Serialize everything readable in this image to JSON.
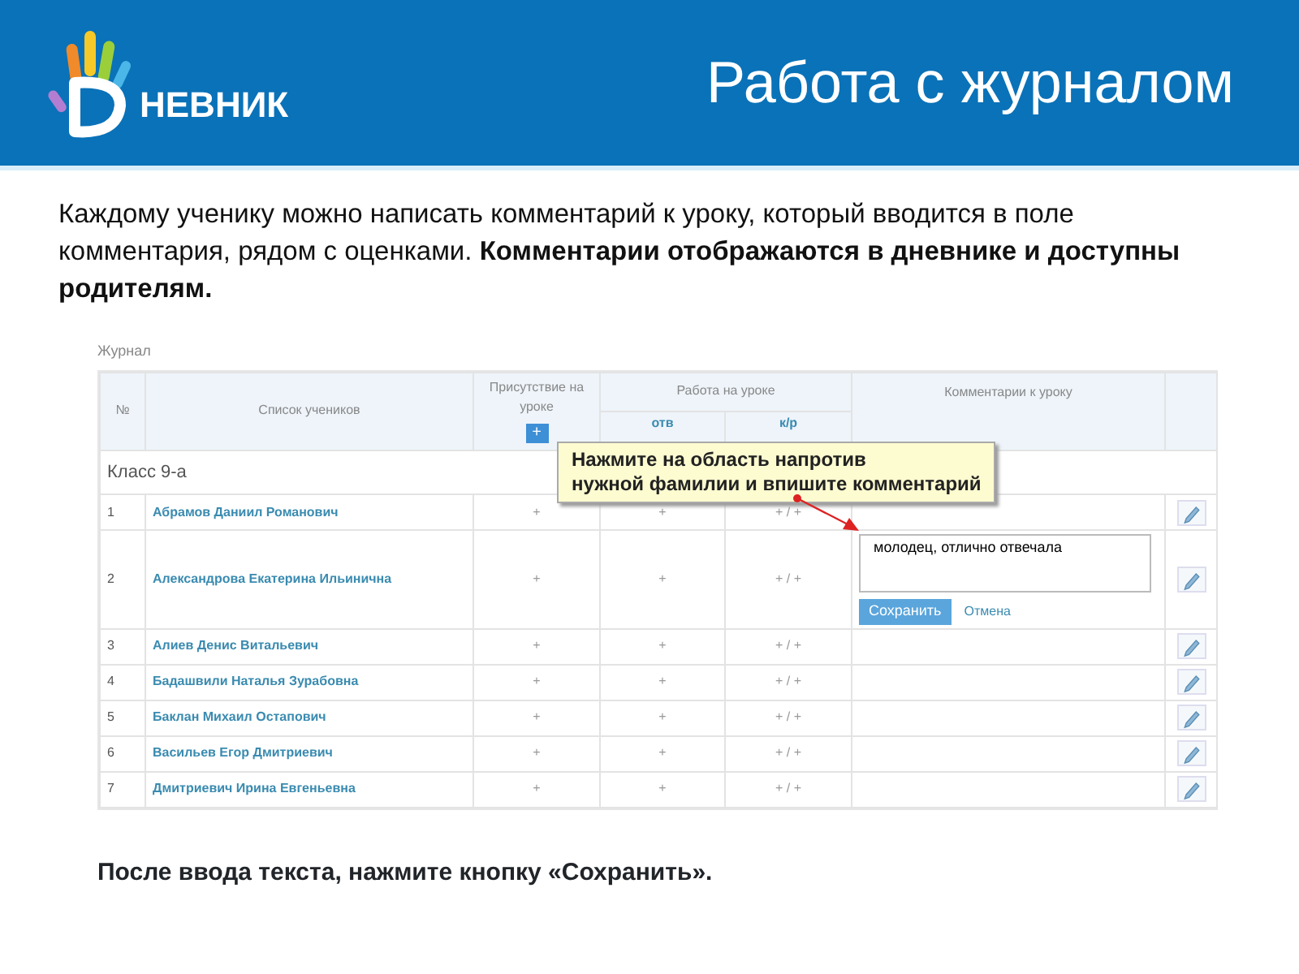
{
  "header": {
    "logo_text": "НЕВНИК",
    "title": "Работа с журналом"
  },
  "intro": "Каждому ученику можно написать комментарий к уроку, который вводится в поле комментария, рядом с оценками. **Комментарии отображаются в дневнике и доступны родителям.**",
  "journal": {
    "title": "Журнал",
    "columns": {
      "number": "№",
      "name": "Список учеников",
      "presence": "Присутствие на уроке",
      "group": "Работа на уроке",
      "answer": "отв",
      "test": "к/р",
      "comment": "Комментарии к уроку"
    },
    "add_button": "+",
    "class_label": "Класс 9-а",
    "rows": [
      {
        "number": "1",
        "name": "Абрамов Даниил Романович",
        "presence": "+",
        "answer": "+",
        "test": "+ / +",
        "editing": false
      },
      {
        "number": "2",
        "name": "Александрова Екатерина Ильинична",
        "presence": "+",
        "answer": "+",
        "test": "+ / +",
        "editing": true
      },
      {
        "number": "3",
        "name": "Алиев Денис Витальевич",
        "presence": "+",
        "answer": "+",
        "test": "+ / +",
        "editing": false
      },
      {
        "number": "4",
        "name": "Бадашвили Наталья Зурабовна",
        "presence": "+",
        "answer": "+",
        "test": "+ / +",
        "editing": false
      },
      {
        "number": "5",
        "name": "Баклан Михаил Остапович",
        "presence": "+",
        "answer": "+",
        "test": "+ / +",
        "editing": false
      },
      {
        "number": "6",
        "name": "Васильев Егор Дмитриевич",
        "presence": "+",
        "answer": "+",
        "test": "+ / +",
        "editing": false
      },
      {
        "number": "7",
        "name": "Дмитриевич Ирина Евгеньевна",
        "presence": "+",
        "answer": "+",
        "test": "+ / +",
        "editing": false
      }
    ],
    "editor": {
      "value": "молодец, отлично отвечала",
      "save": "Сохранить",
      "cancel": "Отмена"
    },
    "tooltip": {
      "lines": [
        "Нажмите на область напротив",
        "нужной фамилии и впишите комментарий"
      ]
    }
  },
  "footer": "После ввода текста, нажмите кнопку «Сохранить»."
}
